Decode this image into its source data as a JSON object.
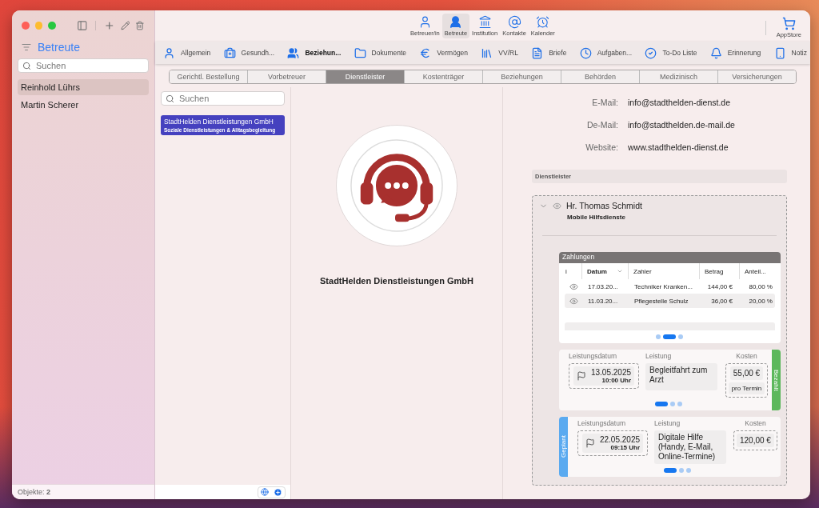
{
  "window": {
    "traffic_lights": [
      {
        "color": "#fe5f57"
      },
      {
        "color": "#febc2e"
      },
      {
        "color": "#28c840"
      }
    ]
  },
  "sidebar": {
    "title": "Betreute",
    "search": {
      "placeholder": "Suchen"
    },
    "items": [
      {
        "label": "Reinhold Lührs",
        "selected": true
      },
      {
        "label": "Martin Scherer",
        "selected": false
      }
    ],
    "status": "Objekte: **2**"
  },
  "toolbar": {
    "items": [
      {
        "label": "Betreuer/in",
        "selected": false
      },
      {
        "label": "Betreute",
        "selected": true
      },
      {
        "label": "Institution",
        "selected": false
      },
      {
        "label": "Kontakte",
        "selected": false
      },
      {
        "label": "Kalender",
        "selected": false
      }
    ],
    "store": "AppStore"
  },
  "nav": [
    {
      "label": "Allgemein",
      "selected": false
    },
    {
      "label": "Gesundh...",
      "selected": false
    },
    {
      "label": "Beziehun...",
      "selected": true
    },
    {
      "label": "Dokumente",
      "selected": false
    },
    {
      "label": "Vermögen",
      "selected": false
    },
    {
      "label": "VV/RL",
      "selected": false
    },
    {
      "label": "Briefe",
      "selected": false
    },
    {
      "label": "Aufgaben...",
      "selected": false
    },
    {
      "label": "To-Do Liste",
      "selected": false
    },
    {
      "label": "Erinnerung",
      "selected": false
    },
    {
      "label": "Notiz",
      "selected": false
    }
  ],
  "tabs": [
    {
      "label": "Gerichtl. Bestellung",
      "selected": false
    },
    {
      "label": "Vorbetreuer",
      "selected": false
    },
    {
      "label": "Dienstleister",
      "selected": true
    },
    {
      "label": "Kostenträger",
      "selected": false
    },
    {
      "label": "Beziehungen",
      "selected": false
    },
    {
      "label": "Behörden",
      "selected": false
    },
    {
      "label": "Medizinisch",
      "selected": false
    },
    {
      "label": "Versicherungen",
      "selected": false
    }
  ],
  "list": {
    "search": {
      "placeholder": "Suchen"
    },
    "items": [
      {
        "title": "StadtHelden Dienstleistungen GmbH",
        "subtitle": "Soziale Dienstleistungen & Alltagsbegleitung",
        "selected": true
      }
    ]
  },
  "profile": {
    "name": "StadtHelden Dienstleistungen GmbH"
  },
  "contact": [
    {
      "label": "E-Mail:",
      "value": "info@stadthelden-dienst.de"
    },
    {
      "label": "De-Mail:",
      "value": "info@stadthelden.de-mail.de"
    },
    {
      "label": "Website:",
      "value": "www.stadthelden-dienst.de"
    }
  ],
  "section": {
    "title": "Dienstleister"
  },
  "provider": {
    "name": "Hr. Thomas Schmidt",
    "role": "Mobile Hilfsdienste",
    "expanded": true,
    "payments": {
      "title": "Zahlungen",
      "columns": [
        "i",
        "Datum",
        "Zahler",
        "Betrag",
        "Anteil..."
      ],
      "rows": [
        {
          "date": "17.03.20...",
          "payer": "Techniker Kranken...",
          "amount": "144,00 €",
          "share": "80,00 %",
          "selected": false
        },
        {
          "date": "11.03.20...",
          "payer": "Pflegestelle Schulz",
          "amount": "36,00 €",
          "share": "20,00 %",
          "selected": true
        }
      ],
      "pager": [
        {
          "selected": false
        },
        {
          "selected": true
        },
        {
          "selected": false
        }
      ]
    },
    "services": [
      {
        "kind": "paid",
        "status": "Bezahlt",
        "color": "#5cb85c",
        "date_label": "Leistungsdatum",
        "date": "13.05.2025",
        "time": "10:00 Uhr",
        "service_label": "Leistung",
        "service": "Begleitfahrt zum Arzt",
        "cost_label": "Kosten",
        "cost": "55,00 €",
        "cost_unit": "pro Termin",
        "pager": [
          {
            "selected": true
          },
          {
            "selected": false
          },
          {
            "selected": false
          }
        ]
      },
      {
        "kind": "planned",
        "status": "Geplant",
        "color": "#5aaaf0",
        "date_label": "Leistungsdatum",
        "date": "22.05.2025",
        "time": "09:15 Uhr",
        "service_label": "Leistung",
        "service": "Digitale Hilfe (Handy, E-Mail, Online-Termine)",
        "cost_label": "Kosten",
        "cost": "120,00 €",
        "pager": [
          {
            "selected": true
          },
          {
            "selected": false
          },
          {
            "selected": false
          }
        ]
      }
    ]
  }
}
